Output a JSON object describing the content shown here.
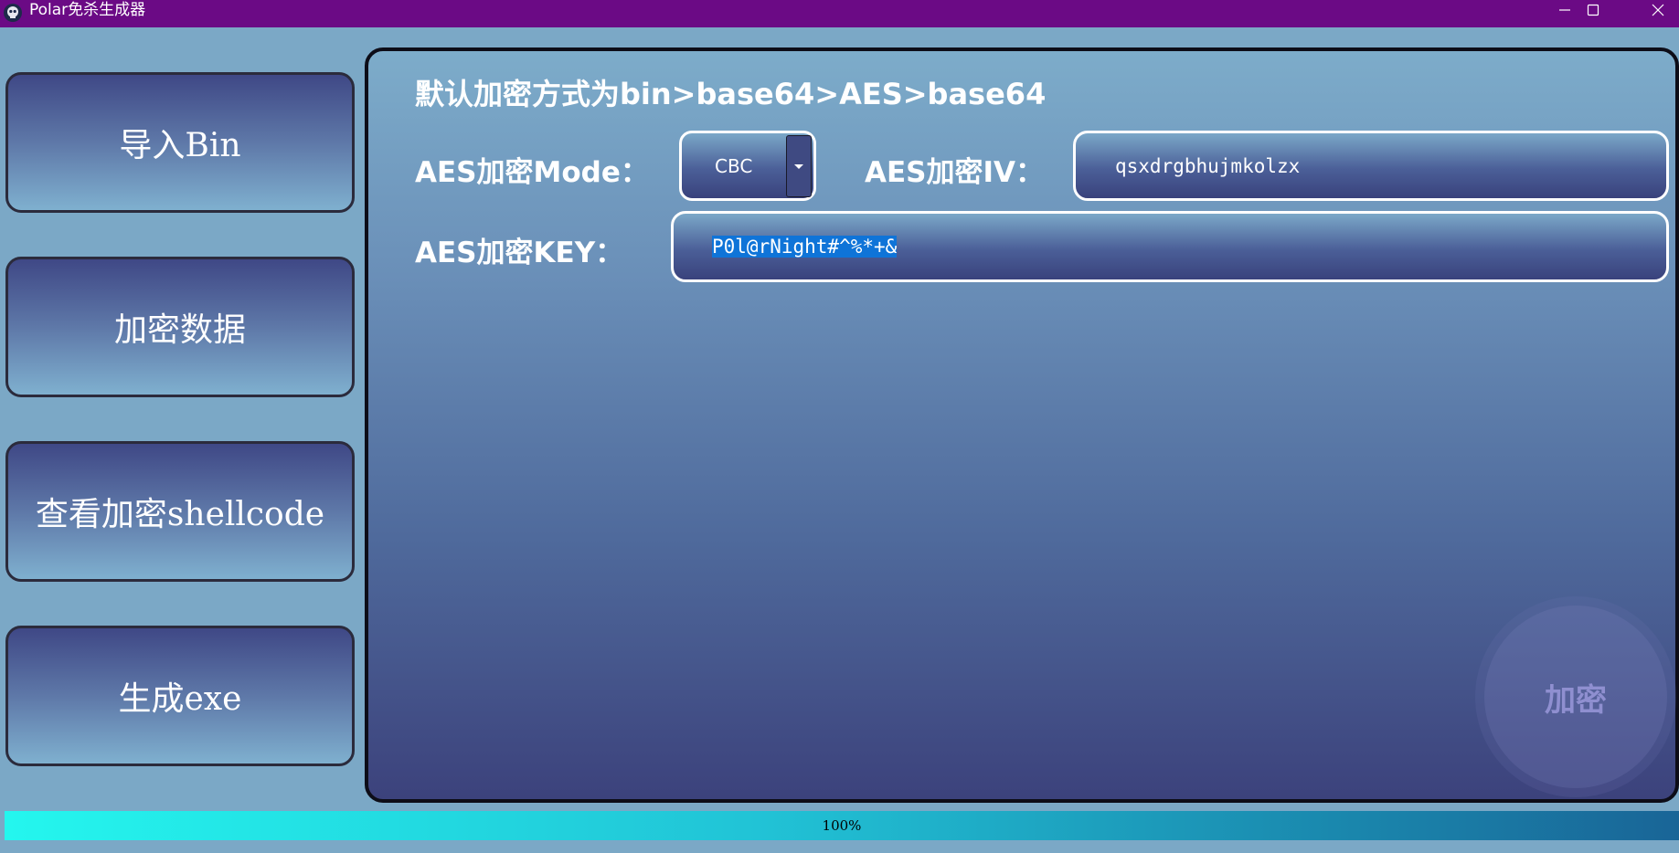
{
  "window": {
    "title": "Polar免杀生成器",
    "app_icon": "skull-icon",
    "controls": [
      "minimize-icon",
      "maximize-icon",
      "close-icon"
    ]
  },
  "sidebar": {
    "buttons": [
      {
        "label": "导入Bin"
      },
      {
        "label": "加密数据"
      },
      {
        "label": "查看加密shellcode"
      },
      {
        "label": "生成exe"
      }
    ]
  },
  "main": {
    "heading": "默认加密方式为bin>base64>AES>base64",
    "mode_label": "AES加密Mode：",
    "mode_value": "CBC",
    "iv_label": "AES加密IV：",
    "iv_value": "qsxdrgbhujmkolzx",
    "key_label": "AES加密KEY：",
    "key_value": "P0l@rNight#^%*+&",
    "encrypt_button": "加密"
  },
  "progress": {
    "value": 100,
    "text": "100%"
  },
  "colors": {
    "titlebar": "#6b0a85",
    "window_bg": "#7ba8c6",
    "selection": "#0f74d8",
    "progress_start": "#24f6ee",
    "progress_end": "#196597"
  }
}
